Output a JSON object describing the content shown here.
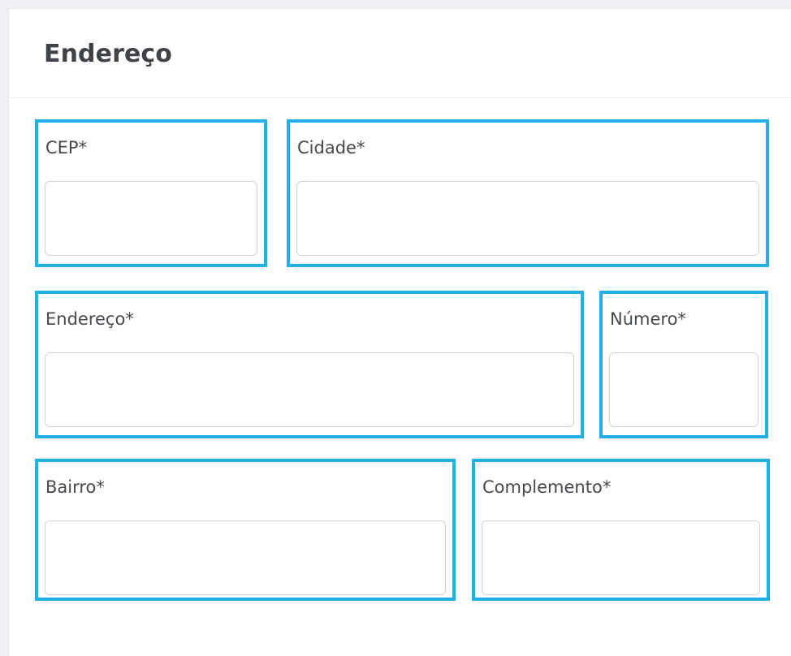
{
  "section": {
    "title": "Endereço"
  },
  "fields": {
    "cep": {
      "label": "CEP*",
      "value": ""
    },
    "cidade": {
      "label": "Cidade*",
      "value": ""
    },
    "endereco": {
      "label": "Endereço*",
      "value": ""
    },
    "numero": {
      "label": "Número*",
      "value": ""
    },
    "bairro": {
      "label": "Bairro*",
      "value": ""
    },
    "complemento": {
      "label": "Complemento*",
      "value": ""
    }
  },
  "colors": {
    "highlight_border": "#22b0ea",
    "input_border": "#cfd3d7",
    "title_text": "#3f4347",
    "page_background": "#eef0f3"
  }
}
